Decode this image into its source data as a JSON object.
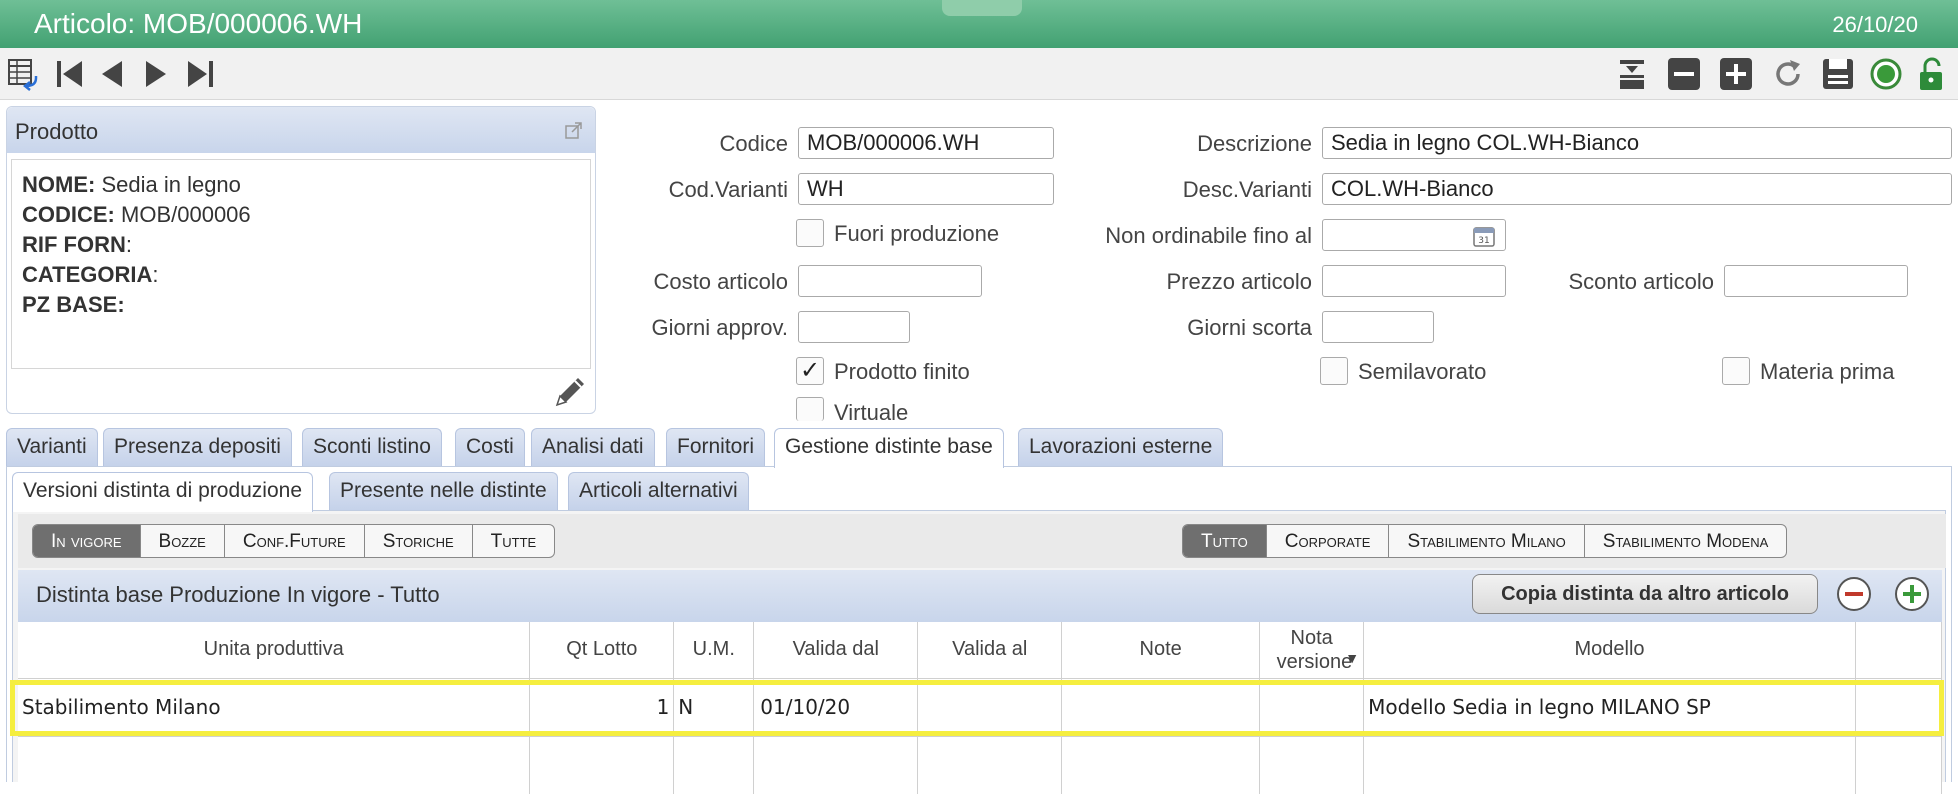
{
  "window": {
    "title": "Articolo: MOB/000006.WH",
    "date": "26/10/20"
  },
  "toolbar": {
    "left_icons": [
      "grid-return-icon",
      "first-record-icon",
      "previous-record-icon",
      "next-record-icon",
      "last-record-icon"
    ],
    "right_icons": [
      "archive-icon",
      "remove-icon",
      "add-icon",
      "refresh-icon",
      "save-icon",
      "status-circle-icon",
      "unlock-icon"
    ]
  },
  "product_panel": {
    "title": "Prodotto",
    "nome_label": "NOME:",
    "nome_value": "Sedia in legno",
    "codice_label": "CODICE:",
    "codice_value": "MOB/000006",
    "rif_label": "RIF FORN",
    "rif_value": ":",
    "categoria_label": "CATEGORIA",
    "categoria_value": ":",
    "pz_label": "PZ BASE:",
    "pz_value": ""
  },
  "form": {
    "codice_label": "Codice",
    "codice_value": "MOB/000006.WH",
    "descrizione_label": "Descrizione",
    "descrizione_value": "Sedia in legno COL.WH-Bianco",
    "cod_varianti_label": "Cod.Varianti",
    "cod_varianti_value": "WH",
    "desc_varianti_label": "Desc.Varianti",
    "desc_varianti_value": "COL.WH-Bianco",
    "fuori_produzione_label": "Fuori produzione",
    "fuori_produzione_checked": false,
    "non_ordinabile_label": "Non ordinabile fino al",
    "non_ordinabile_value": "",
    "costo_label": "Costo articolo",
    "costo_value": "",
    "prezzo_label": "Prezzo articolo",
    "prezzo_value": "",
    "sconto_label": "Sconto articolo",
    "sconto_value": "",
    "giorni_approv_label": "Giorni approv.",
    "giorni_approv_value": "",
    "giorni_scorta_label": "Giorni scorta",
    "giorni_scorta_value": "",
    "prodotto_finito_label": "Prodotto finito",
    "prodotto_finito_checked": true,
    "semilavorato_label": "Semilavorato",
    "semilavorato_checked": false,
    "materia_prima_label": "Materia prima",
    "materia_prima_checked": false,
    "virtuale_label": "Virtuale",
    "virtuale_checked": false,
    "checkmark": "✓"
  },
  "tabs": [
    "Varianti",
    "Presenza depositi",
    "Sconti listino",
    "Costi",
    "Analisi dati",
    "Fornitori",
    "Gestione distinte base",
    "Lavorazioni esterne"
  ],
  "active_tab": "Gestione distinte base",
  "subtabs": [
    "Versioni distinta di produzione",
    "Presente nelle distinte",
    "Articoli alternativi"
  ],
  "active_subtab": "Versioni distinta di produzione",
  "status_filters": [
    "In vigore",
    "Bozze",
    "Conf.Future",
    "Storiche",
    "Tutte"
  ],
  "active_status_filter": "In vigore",
  "plant_filters": [
    "Tutto",
    "Corporate",
    "Stabilimento Milano",
    "Stabilimento Modena"
  ],
  "active_plant_filter": "Tutto",
  "grid": {
    "title": "Distinta base Produzione In vigore - Tutto",
    "copy_button": "Copia distinta da altro articolo",
    "columns": [
      "Unita produttiva",
      "Qt Lotto",
      "U.M.",
      "Valida dal",
      "Valida al",
      "Note",
      "Nota versione",
      "Modello"
    ],
    "rows": [
      [
        "Stabilimento Milano",
        "1",
        "N",
        "01/10/20",
        "",
        "",
        "",
        "Modello Sedia in legno MILANO SP"
      ]
    ]
  },
  "colors": {
    "title_bar": "#42a172",
    "tab_bg": "#c5d2ea",
    "highlight": "#f5ee3f",
    "remove_button": "#c0392b",
    "add_button": "#3a9a3a"
  }
}
